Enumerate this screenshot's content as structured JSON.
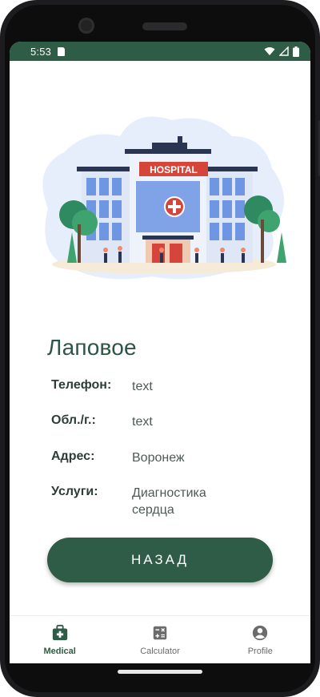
{
  "status_bar": {
    "time": "5:53"
  },
  "hero": {
    "sign_text": "HOSPITAL"
  },
  "place": {
    "title": "Лаповое",
    "rows": [
      {
        "label": "Телефон:",
        "value": "text"
      },
      {
        "label": "Обл./г.:",
        "value": "text"
      },
      {
        "label": "Адрес:",
        "value": "Воронеж"
      },
      {
        "label": "Услуги:",
        "value_line1": "Диагностика",
        "value_line2": "сердца"
      }
    ]
  },
  "back_button": {
    "label": "НАЗАД"
  },
  "bottom_nav": {
    "items": [
      {
        "label": "Medical",
        "icon": "medical-kit-icon",
        "active": true
      },
      {
        "label": "Calculator",
        "icon": "calculator-icon",
        "active": false
      },
      {
        "label": "Profile",
        "icon": "profile-icon",
        "active": false
      }
    ]
  },
  "colors": {
    "primary": "#2f5c46",
    "text_dark": "#2e3d36",
    "text_value": "#4e5a54"
  }
}
